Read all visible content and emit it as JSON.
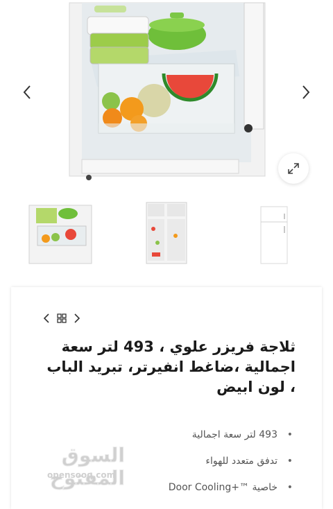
{
  "gallery": {
    "main_image": "fridge-open-crisper-drawer",
    "prev_icon": "chevron-left-icon",
    "next_icon": "chevron-right-icon",
    "zoom_icon": "expand-icon"
  },
  "thumbnails": [
    {
      "image": "fridge-crisper-closeup"
    },
    {
      "image": "fridge-open-front"
    },
    {
      "image": "fridge-closed-white"
    }
  ],
  "product": {
    "title": "ثلاجة فريزر علوي ، 493 لتر سعة اجمالية ،ضاغط انفيرتر، تبريد الباب ، لون ابيض",
    "features": [
      "493 لتر سعة اجمالية",
      "تدفق متعدد للهواء",
      "خاصية ™+Door Cooling"
    ],
    "bullet": "•"
  },
  "watermark": {
    "arabic": "السوق المفتوح",
    "english": "opensooq.com"
  }
}
